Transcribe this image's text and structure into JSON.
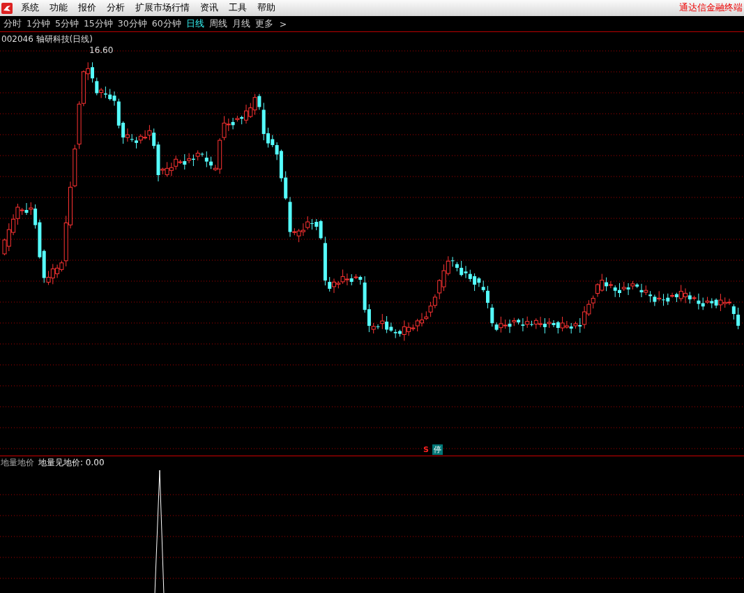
{
  "menu": {
    "items": [
      "系统",
      "功能",
      "报价",
      "分析",
      "扩展市场行情",
      "资讯",
      "工具",
      "帮助"
    ],
    "brand": "通达信金融终端"
  },
  "periods": [
    {
      "label": "分时",
      "selected": false
    },
    {
      "label": "1分钟",
      "selected": false
    },
    {
      "label": "5分钟",
      "selected": false
    },
    {
      "label": "15分钟",
      "selected": false
    },
    {
      "label": "30分钟",
      "selected": false
    },
    {
      "label": "60分钟",
      "selected": false
    },
    {
      "label": "日线",
      "selected": true
    },
    {
      "label": "周线",
      "selected": false
    },
    {
      "label": "月线",
      "selected": false
    }
  ],
  "more": {
    "label": "更多",
    "chevron": ">"
  },
  "chart": {
    "title": "002046 轴研科技(日线)",
    "high_label": "16.60",
    "signal_mark": "S",
    "badge": "停"
  },
  "indicator": {
    "name": "地量地价",
    "reading": "地量见地价: 0.00"
  }
}
